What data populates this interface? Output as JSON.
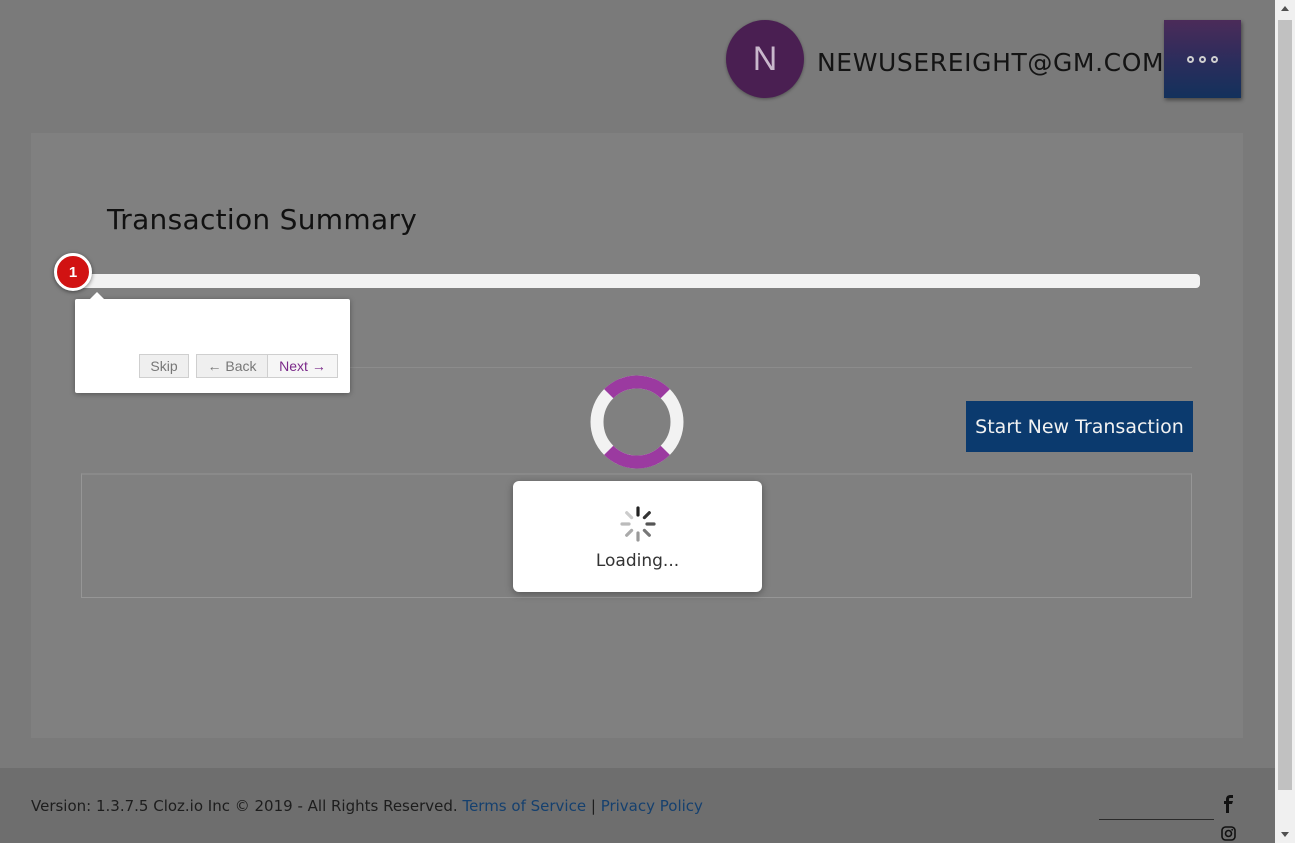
{
  "header": {
    "avatar_initial": "N",
    "user_email": "NEWUSEREIGHT@GM.COM",
    "menu_icon": "more-dots-icon"
  },
  "main": {
    "title": "Transaction Summary",
    "step_number": "1",
    "start_button_label": "Start New Transaction"
  },
  "tour": {
    "skip_label": "Skip",
    "back_label": "← Back",
    "next_label": "Next →"
  },
  "loading": {
    "text": "Loading..."
  },
  "footer": {
    "version_text": "Version: 1.3.7.5  Cloz.io Inc © 2019 - All Rights Reserved.",
    "terms_label": "Terms of Service",
    "separator": "|",
    "privacy_label": "Privacy Policy",
    "social_icons": [
      "facebook-icon",
      "instagram-icon"
    ]
  },
  "colors": {
    "overlay_gray": "#7a7a7a",
    "avatar_purple": "#4a1f52",
    "primary_blue": "#0b3a6e",
    "step_red": "#d11212",
    "spinner_purple": "#9b3aa0",
    "link_blue": "#15406e"
  }
}
